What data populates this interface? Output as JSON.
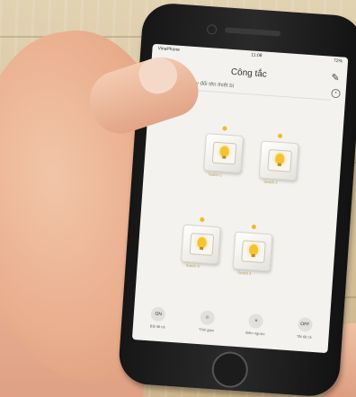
{
  "status": {
    "carrier": "VinaPhone",
    "time": "11:08",
    "battery": "72%"
  },
  "app": {
    "title": "Công tắc",
    "subtitle": "Nhấn giữ để thay đổi tên thiết bị"
  },
  "switches": [
    {
      "label": "Switch 1"
    },
    {
      "label": "Switch 2"
    },
    {
      "label": "Switch 3"
    },
    {
      "label": "Switch 4"
    }
  ],
  "bottom_bar": [
    {
      "icon": "ON",
      "label": "Bật tất cả"
    },
    {
      "icon": "⏲",
      "label": "Thời gian"
    },
    {
      "icon": "≡",
      "label": "Đếm ngược"
    },
    {
      "icon": "OFF",
      "label": "Tắt tất cả"
    }
  ]
}
